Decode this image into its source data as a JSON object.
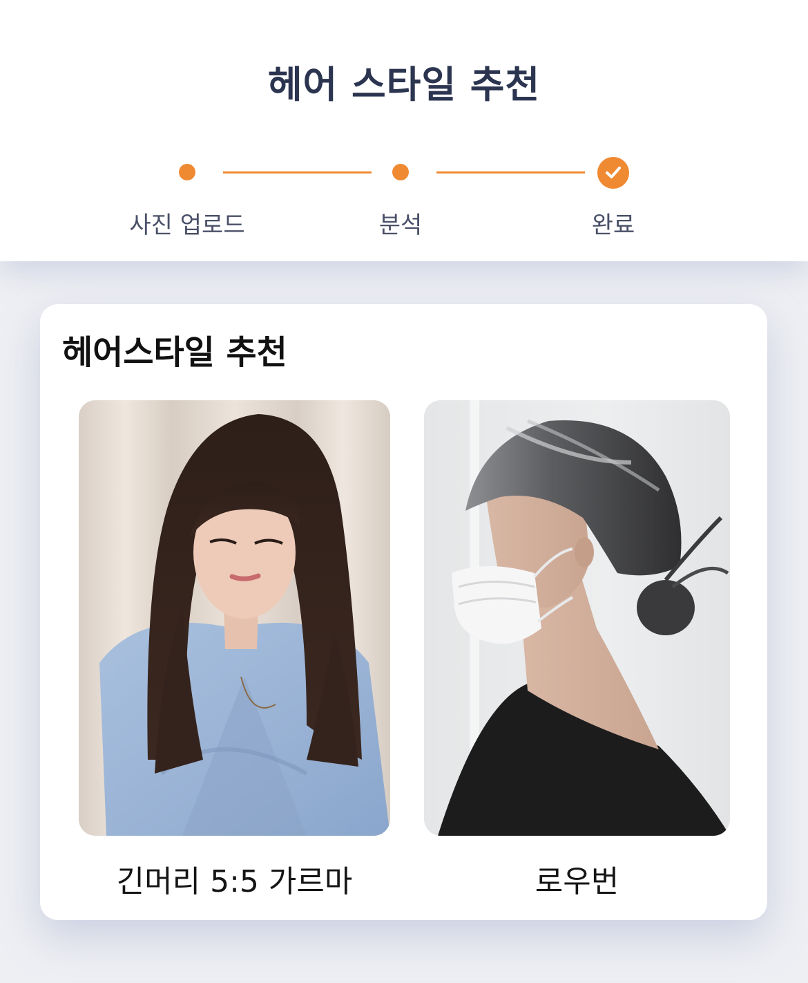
{
  "header": {
    "title": "헤어 스타일 추천"
  },
  "steps": [
    {
      "label": "사진 업로드",
      "state": "done"
    },
    {
      "label": "분석",
      "state": "done"
    },
    {
      "label": "완료",
      "state": "current-check"
    }
  ],
  "colors": {
    "accent": "#f08a32",
    "title": "#2c3550",
    "step_label": "#4a5068",
    "page_bg": "#eeeff3",
    "card_bg": "#ffffff"
  },
  "recommendation": {
    "title": "헤어스타일 추천",
    "items": [
      {
        "name": "긴머리 5:5 가르마",
        "image": "long-hair-photo"
      },
      {
        "name": "로우번",
        "image": "low-bun-photo"
      }
    ]
  }
}
